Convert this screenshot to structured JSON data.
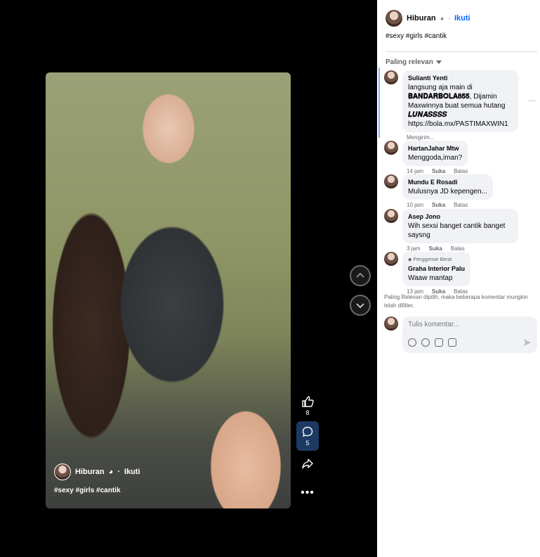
{
  "post": {
    "author": "Hiburan",
    "privacy_icon": "globe-icon",
    "separator": "·",
    "follow_label": "Ikuti",
    "hashtags": "#sexy #girls #cantik"
  },
  "actions": {
    "like_count": "8",
    "comment_count": "5"
  },
  "comments_header": {
    "sort_label": "Paling relevan"
  },
  "comments": [
    {
      "author": "Sulianti Yenti",
      "line1": "langsung aja main di",
      "line2_bold": "𝐁𝐀𝐍𝐃𝐀𝐑𝐁𝐎𝐋𝐀𝟖𝟓𝟓",
      "line2_rest": ", Dijamin",
      "line3": "Maxwinnya buat semua hutang",
      "line4_bold": "𝑳𝑼𝑵𝑨𝑺𝑺𝑺𝑺",
      "line5": "https://bola.mx/PASTIMAXWIN1",
      "status": "Mengirim..."
    },
    {
      "author": "HartanJahar Mtw",
      "text": "Menggoda,iman?",
      "time": "14 jam",
      "like": "Suka",
      "reply": "Balas"
    },
    {
      "author": "Mundu E Rosadi",
      "text": "Mulusnya JD kepengen...",
      "time": "10 jam",
      "like": "Suka",
      "reply": "Balas"
    },
    {
      "author": "Asep Jono",
      "text": "Wih sexsi banget cantik banget saysng",
      "time": "3 jam",
      "like": "Suka",
      "reply": "Balas"
    },
    {
      "badge": "Penggemar Berat",
      "author": "Graha Interior Palu",
      "text": "Waaw mantap",
      "time": "13 jam",
      "like": "Suka",
      "reply": "Balas"
    }
  ],
  "notice": "Paling Relevan dipilih, maka beberapa komentar mungkin telah difilter.",
  "composer": {
    "placeholder": "Tulis komentar..."
  },
  "colors": {
    "accent": "#0866ff",
    "stage_bg": "#000000",
    "bubble_bg": "#f0f2f5"
  }
}
